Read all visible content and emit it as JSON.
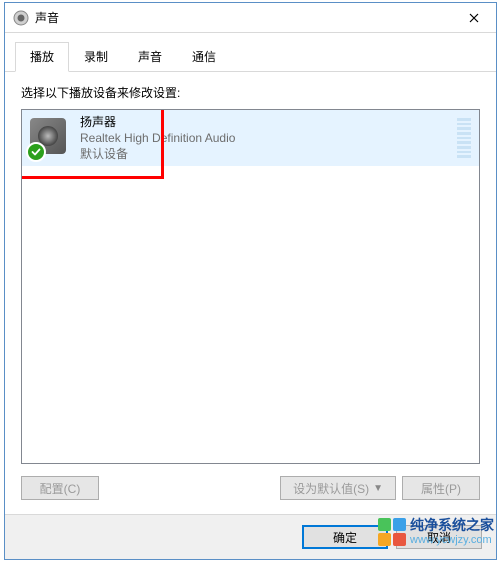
{
  "window": {
    "title": "声音"
  },
  "tabs": [
    {
      "label": "播放",
      "active": true
    },
    {
      "label": "录制",
      "active": false
    },
    {
      "label": "声音",
      "active": false
    },
    {
      "label": "通信",
      "active": false
    }
  ],
  "instruction": "选择以下播放设备来修改设置:",
  "device": {
    "name": "扬声器",
    "description": "Realtek High Definition Audio",
    "status": "默认设备",
    "icon": "speaker-icon",
    "checked": true
  },
  "buttons": {
    "configure": "配置(C)",
    "setDefault": "设为默认值(S)",
    "properties": "属性(P)",
    "ok": "确定",
    "cancel": "取消"
  },
  "watermark": {
    "title": "纯净系统之家",
    "url": "www.ycwjzy.com",
    "colors": [
      "#49c35a",
      "#3aa0e8",
      "#f5a623",
      "#e9573f"
    ]
  }
}
